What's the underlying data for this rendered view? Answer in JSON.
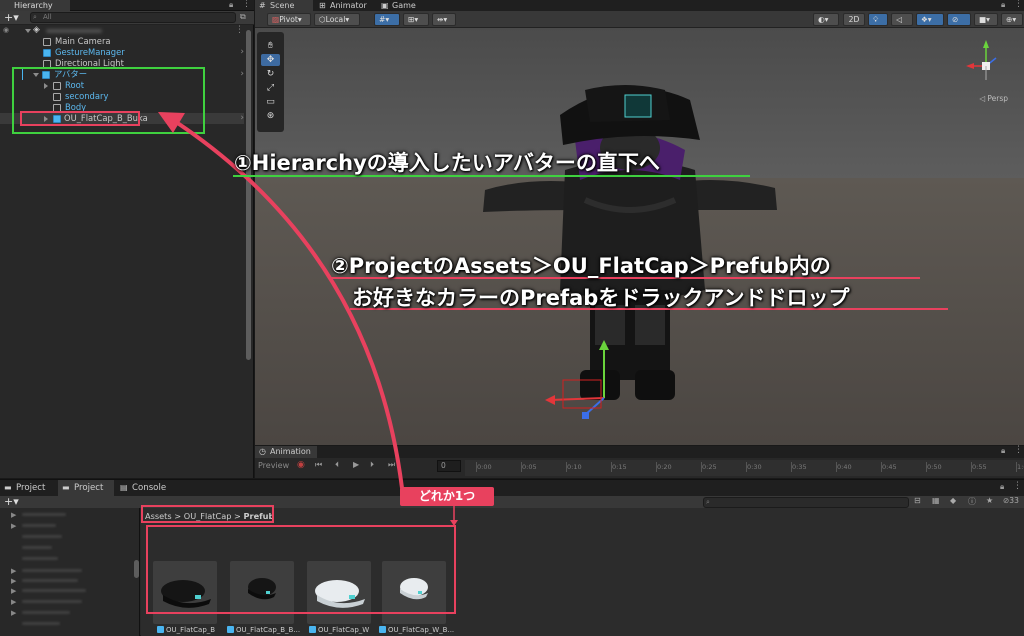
{
  "hierarchy": {
    "tab": "Hierarchy",
    "search_placeholder": "All",
    "scene_name": "",
    "items": [
      {
        "label": "Main Camera",
        "blue": false
      },
      {
        "label": "GestureManager",
        "blue": true
      },
      {
        "label": "Directional Light",
        "blue": false
      },
      {
        "label": "アバター",
        "blue": true
      },
      {
        "label": "Root",
        "blue": true
      },
      {
        "label": "secondary",
        "blue": true
      },
      {
        "label": "Body",
        "blue": true
      },
      {
        "label": "OU_FlatCap_B_Buka",
        "blue": false
      }
    ]
  },
  "scene": {
    "tabs": [
      "Scene",
      "Animator",
      "Game"
    ],
    "pivot": "Pivot",
    "local": "Local",
    "mode_2d": "2D",
    "persp": "Persp"
  },
  "animation": {
    "tab": "Animation",
    "preview": "Preview",
    "frame": "0",
    "ticks": [
      "0:00",
      "0:05",
      "0:10",
      "0:15",
      "0:20",
      "0:25",
      "0:30",
      "0:35",
      "0:40",
      "0:45",
      "0:50",
      "0:55",
      "1:00"
    ]
  },
  "project": {
    "tabs": [
      "Project",
      "Project",
      "Console"
    ],
    "breadcrumb": {
      "root": "Assets",
      "sep1": ">",
      "mid": "OU_FlatCap",
      "sep2": ">",
      "last": "Prefub"
    },
    "count": "33",
    "assets": [
      {
        "label": "OU_FlatCap_B",
        "color": "#151515"
      },
      {
        "label": "OU_FlatCap_B_B...",
        "color": "#151515"
      },
      {
        "label": "OU_FlatCap_W",
        "color": "#e8ecef"
      },
      {
        "label": "OU_FlatCap_W_B...",
        "color": "#e8ecef"
      }
    ]
  },
  "annotations": {
    "step1": "①Hierarchyの導入したいアバターの直下へ",
    "step2_line1": "②ProjectのAssets＞OU_FlatCap＞Prefub内の",
    "step2_line2": "お好きなカラーのPrefabをドラックアンドドロップ",
    "pick_one": "どれか1つ",
    "accent_red": "#e8415e",
    "accent_green": "#3fd13f"
  }
}
